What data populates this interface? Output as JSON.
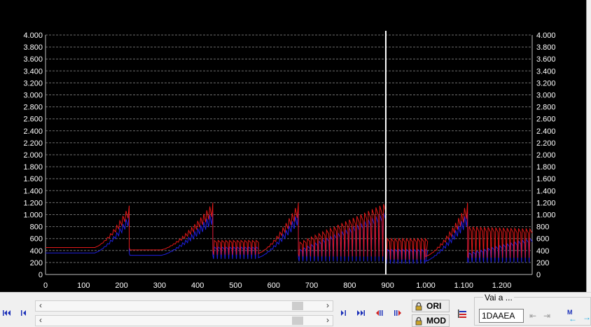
{
  "colors": {
    "background": "#000000",
    "grid": "#6e6e6e",
    "axis_text": "#ffffff",
    "cursor": "#ffffff",
    "series_ori": "#2020e0",
    "series_mod": "#e01818"
  },
  "toolbar": {
    "ori_label": "ORI",
    "mod_label": "MOD",
    "goto_label": "Vai a ...",
    "address_value": "1DAAEA"
  },
  "icons": {
    "first": "skip-to-start-icon",
    "prev": "step-back-icon",
    "next": "step-forward-icon",
    "last": "skip-to-end-icon",
    "prev_diff": "previous-difference-icon",
    "next_diff": "next-difference-icon",
    "lock_ori": "lock-icon",
    "lock_mod": "lock-icon",
    "compare": "compare-icon"
  },
  "chart_data": {
    "type": "line",
    "xlim": [
      0,
      1280
    ],
    "ylim": [
      0,
      4000
    ],
    "x_ticks": [
      "0",
      "100",
      "200",
      "300",
      "400",
      "500",
      "600",
      "700",
      "800",
      "900",
      "1.000",
      "1.100",
      "1.200"
    ],
    "x_tick_values": [
      0,
      100,
      200,
      300,
      400,
      500,
      600,
      700,
      800,
      900,
      1000,
      1100,
      1200
    ],
    "y_ticks": [
      "0",
      "200",
      "400",
      "600",
      "800",
      "1.000",
      "1.200",
      "1.400",
      "1.600",
      "1.800",
      "2.000",
      "2.200",
      "2.400",
      "2.600",
      "2.800",
      "3.000",
      "3.200",
      "3.400",
      "3.600",
      "3.800",
      "4.000"
    ],
    "y_tick_values": [
      0,
      200,
      400,
      600,
      800,
      1000,
      1200,
      1400,
      1600,
      1800,
      2000,
      2200,
      2400,
      2600,
      2800,
      3000,
      3200,
      3400,
      3600,
      3800,
      4000
    ],
    "grid": true,
    "cursor_x": 895,
    "series": [
      {
        "color": "#2020e0",
        "segments": [
          {
            "kind": "ramp",
            "x0": 0,
            "x1": 220,
            "flat_until": 130,
            "base": 360,
            "peak": 1000
          },
          {
            "kind": "ramp",
            "x0": 222,
            "x1": 440,
            "flat_until": 305,
            "base": 320,
            "peak": 1050
          },
          {
            "kind": "osc",
            "x0": 442,
            "x1": 560,
            "low": 260,
            "high": 460
          },
          {
            "kind": "ramp",
            "x0": 560,
            "x1": 665,
            "flat_until": 560,
            "base": 280,
            "peak": 1050
          },
          {
            "kind": "osc_ramp",
            "x0": 667,
            "x1": 895,
            "low": 220,
            "high_start": 420,
            "high_end": 1050
          },
          {
            "kind": "osc",
            "x0": 897,
            "x1": 1000,
            "low": 180,
            "high": 420
          },
          {
            "kind": "ramp",
            "x0": 1000,
            "x1": 1110,
            "flat_until": 1000,
            "base": 220,
            "peak": 1050
          },
          {
            "kind": "osc_ramp",
            "x0": 1112,
            "x1": 1280,
            "low": 200,
            "high_start": 360,
            "high_end": 620
          }
        ]
      },
      {
        "color": "#e01818",
        "segments": [
          {
            "kind": "ramp",
            "x0": 0,
            "x1": 220,
            "flat_until": 130,
            "base": 450,
            "peak": 1150
          },
          {
            "kind": "ramp",
            "x0": 222,
            "x1": 440,
            "flat_until": 305,
            "base": 410,
            "peak": 1200
          },
          {
            "kind": "osc",
            "x0": 442,
            "x1": 560,
            "low": 330,
            "high": 570
          },
          {
            "kind": "ramp",
            "x0": 560,
            "x1": 665,
            "flat_until": 560,
            "base": 350,
            "peak": 1200
          },
          {
            "kind": "osc_ramp",
            "x0": 667,
            "x1": 895,
            "low": 300,
            "high_start": 540,
            "high_end": 1200
          },
          {
            "kind": "osc",
            "x0": 897,
            "x1": 1000,
            "low": 250,
            "high": 600
          },
          {
            "kind": "ramp",
            "x0": 1000,
            "x1": 1110,
            "flat_until": 1000,
            "base": 300,
            "peak": 1200
          },
          {
            "kind": "osc_ramp",
            "x0": 1112,
            "x1": 1280,
            "low": 280,
            "high_start": 800,
            "high_end": 760
          }
        ]
      }
    ]
  }
}
